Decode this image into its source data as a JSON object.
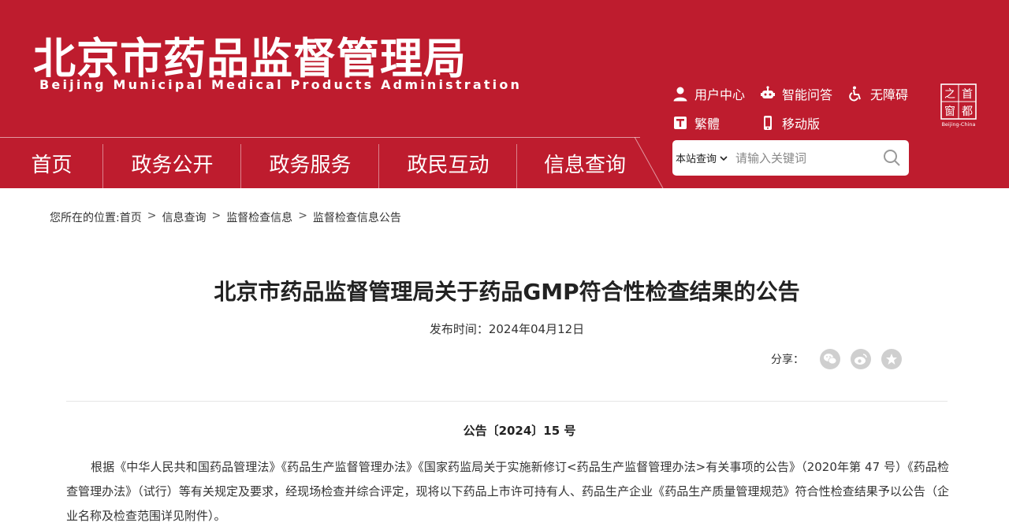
{
  "header": {
    "site_title": "北京市药品监督管理局",
    "site_subtitle": "Beijing Municipal Medical Products Administration",
    "brand_color": "#be1c2e",
    "utilities": {
      "user_center": "用户中心",
      "smart_qa": "智能问答",
      "accessibility": "无障碍",
      "traditional": "繁體",
      "mobile": "移动版"
    },
    "seal": {
      "chars": [
        "首",
        "都",
        "之",
        "窗"
      ],
      "caption": "Beijing-China"
    }
  },
  "nav": {
    "items": [
      "首页",
      "政务公开",
      "政务服务",
      "政民互动",
      "信息查询"
    ]
  },
  "search": {
    "scope": "本站查询",
    "placeholder": "请输入关键词"
  },
  "breadcrumb": {
    "prefix": "您所在的位置:",
    "items": [
      "首页",
      "信息查询",
      "监督检查信息",
      "监督检查信息公告"
    ],
    "separator": ">"
  },
  "article": {
    "title": "北京市药品监督管理局关于药品GMP符合性检查结果的公告",
    "date_label": "发布时间：",
    "date": "2024年04月12日",
    "share_label": "分享：",
    "share_icons": [
      "wechat-icon",
      "weibo-icon",
      "favorite-icon"
    ],
    "notice_number": "公告〔2024〕15 号",
    "body": "根据《中华人民共和国药品管理法》《药品生产监督管理办法》《国家药监局关于实施新修订<药品生产监督管理办法>有关事项的公告》（2020年第 47 号）《药品检查管理办法》（试行）等有关规定及要求，经现场检查并综合评定，现将以下药品上市许可持有人、药品生产企业《药品生产质量管理规范》符合性检查结果予以公告（企业名称及检查范围详见附件）。"
  }
}
